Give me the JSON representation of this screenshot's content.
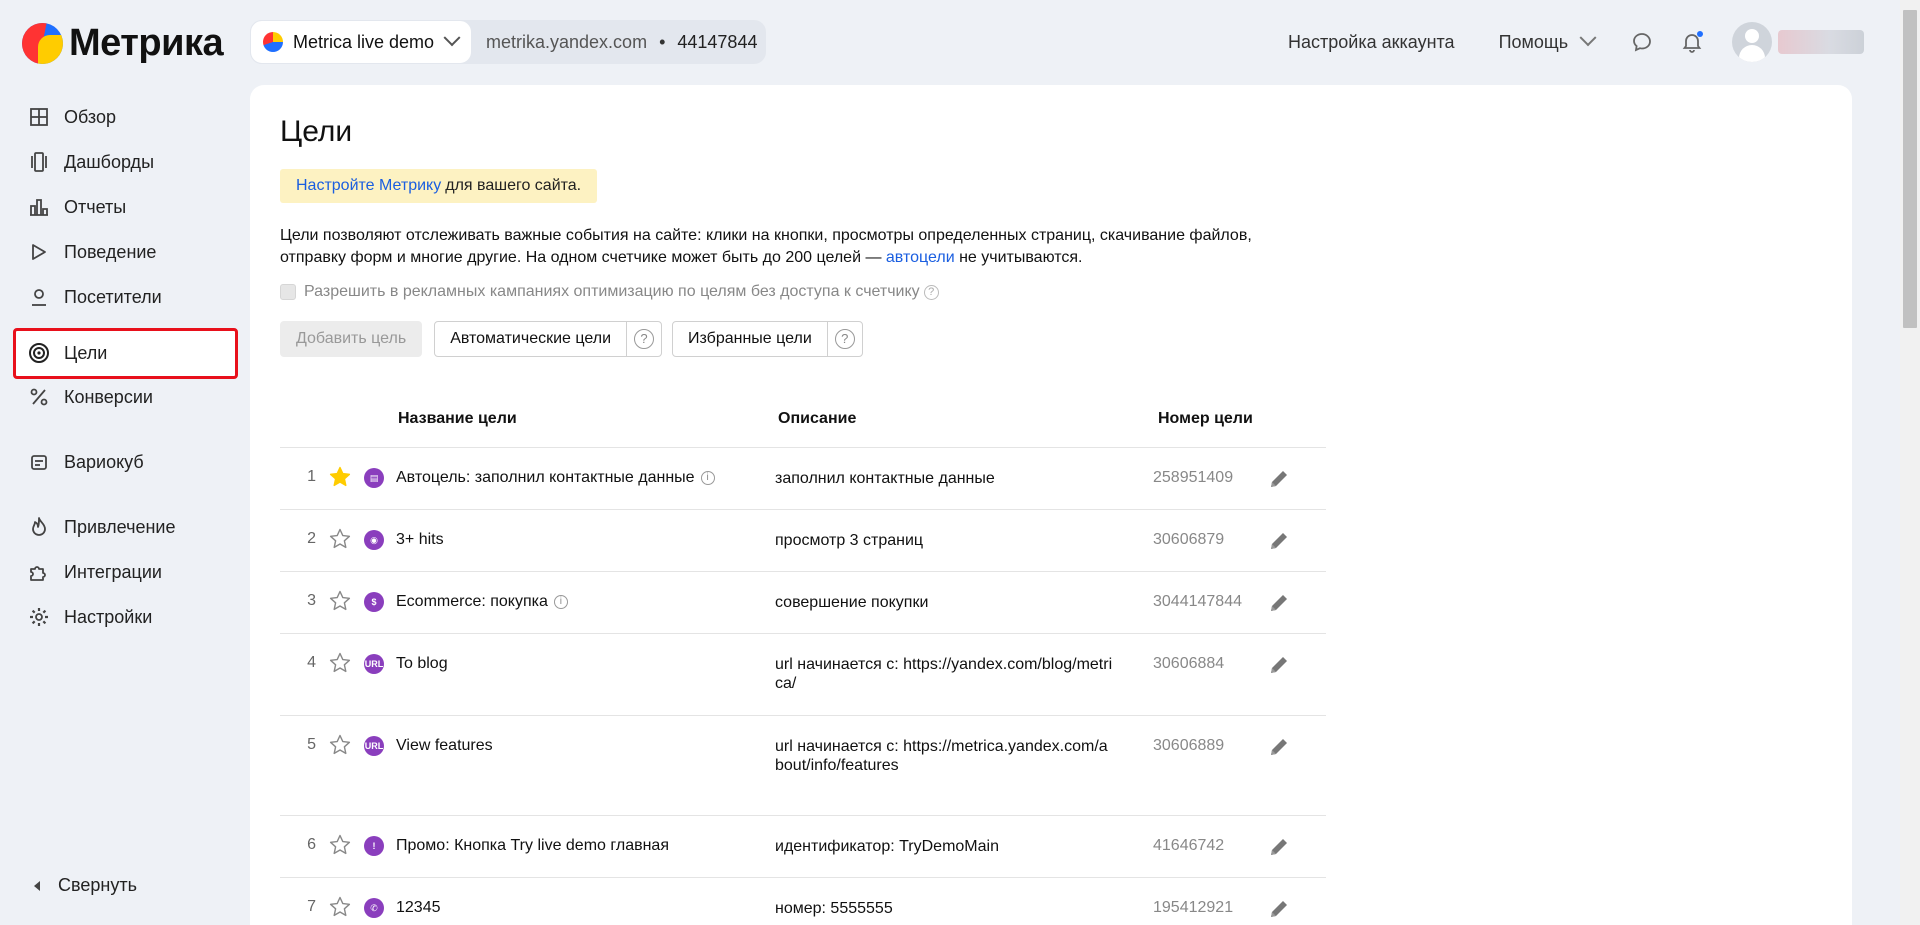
{
  "brand": {
    "logo_text": "Метрика"
  },
  "counter": {
    "name": "Metrica live demo",
    "domain": "metrika.yandex.com",
    "separator": "•",
    "id": "44147844"
  },
  "topnav": {
    "account_settings": "Настройка аккаунта",
    "help": "Помощь"
  },
  "sidebar": {
    "items": [
      {
        "label": "Обзор",
        "icon": "grid-icon"
      },
      {
        "label": "Дашборды",
        "icon": "dashboards-icon"
      },
      {
        "label": "Отчеты",
        "icon": "reports-icon"
      },
      {
        "label": "Поведение",
        "icon": "play-icon"
      },
      {
        "label": "Посетители",
        "icon": "user-icon"
      },
      {
        "label": "Цели",
        "icon": "target-icon"
      },
      {
        "label": "Конверсии",
        "icon": "percent-icon"
      },
      {
        "label": "Вариокуб",
        "icon": "variocube-icon"
      },
      {
        "label": "Привлечение",
        "icon": "fire-icon"
      },
      {
        "label": "Интеграции",
        "icon": "puzzle-icon"
      },
      {
        "label": "Настройки",
        "icon": "gear-icon"
      }
    ],
    "collapse": "Свернуть"
  },
  "page": {
    "title": "Цели",
    "notice_link": "Настройте Метрику",
    "notice_text": "для вашего сайта.",
    "description_1": "Цели позволяют отслеживать важные события на сайте: клики на кнопки, просмотры определенных страниц, скачивание файлов, отправку форм и многие другие. На одном счетчике может быть до 200 целей —",
    "description_link": "автоцели",
    "description_2": "не учитываются.",
    "option_label": "Разрешить в рекламных кампаниях оптимизацию по целям без доступа к счетчику",
    "buttons": {
      "add_goal": "Добавить цель",
      "auto_goals": "Автоматические цели",
      "favorite_goals": "Избранные цели",
      "help_glyph": "?"
    }
  },
  "table": {
    "headers": {
      "name": "Название цели",
      "description": "Описание",
      "id": "Номер цели"
    },
    "rows": [
      {
        "n": "1",
        "name": "Автоцель: заполнил контактные данные",
        "description": "заполнил контактные данные",
        "id": "258951409",
        "starred": true,
        "info": true,
        "type_glyph": "▤"
      },
      {
        "n": "2",
        "name": "3+ hits",
        "description": "просмотр 3 страниц",
        "id": "30606879",
        "starred": false,
        "info": false,
        "type_glyph": "◉"
      },
      {
        "n": "3",
        "name": "Ecommerce: покупка",
        "description": "совершение покупки",
        "id": "3044147844",
        "starred": false,
        "info": true,
        "type_glyph": "$"
      },
      {
        "n": "4",
        "name": "To blog",
        "description": "url начинается с: https://yandex.com/blog/metrica/",
        "id": "30606884",
        "starred": false,
        "info": false,
        "type_glyph": "URL"
      },
      {
        "n": "5",
        "name": "View features",
        "description": "url начинается с: https://metrica.yandex.com/about/info/features",
        "id": "30606889",
        "starred": false,
        "info": false,
        "type_glyph": "URL"
      },
      {
        "n": "6",
        "name": "Промо: Кнопка Try live demo главная",
        "description": "идентификатор: TryDemoMain",
        "id": "41646742",
        "starred": false,
        "info": false,
        "type_glyph": "!"
      },
      {
        "n": "7",
        "name": "12345",
        "description": "номер: 5555555",
        "id": "195412921",
        "starred": false,
        "info": false,
        "type_glyph": "✆"
      }
    ]
  },
  "colors": {
    "accent": "#1a5ee0",
    "goal_type": "#8a3ebd",
    "star": "#ffcc00",
    "highlight_border": "#e8101b",
    "notice_bg": "#fdf2c2"
  }
}
